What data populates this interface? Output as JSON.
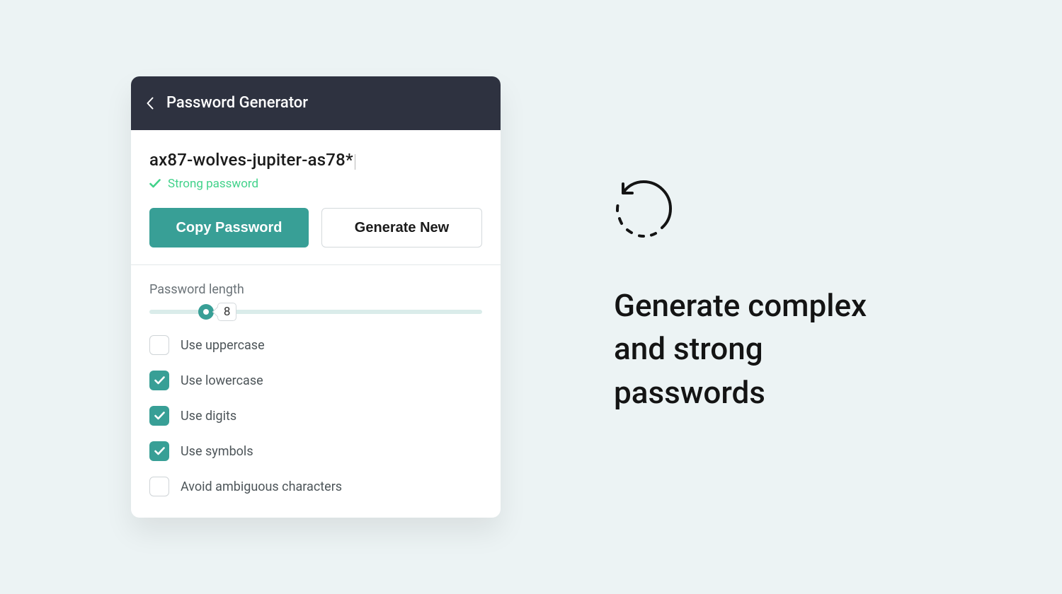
{
  "header": {
    "title": "Password Generator"
  },
  "password": {
    "value": "ax87-wolves-jupiter-as78*",
    "strength": "Strong password"
  },
  "buttons": {
    "copy": "Copy Password",
    "generate": "Generate New"
  },
  "length": {
    "label": "Password length",
    "value": "8"
  },
  "options": [
    {
      "label": "Use uppercase",
      "checked": false
    },
    {
      "label": "Use lowercase",
      "checked": true
    },
    {
      "label": "Use digits",
      "checked": true
    },
    {
      "label": "Use symbols",
      "checked": true
    },
    {
      "label": "Avoid ambiguous characters",
      "checked": false
    }
  ],
  "hero": {
    "text": "Generate complex and strong passwords"
  }
}
